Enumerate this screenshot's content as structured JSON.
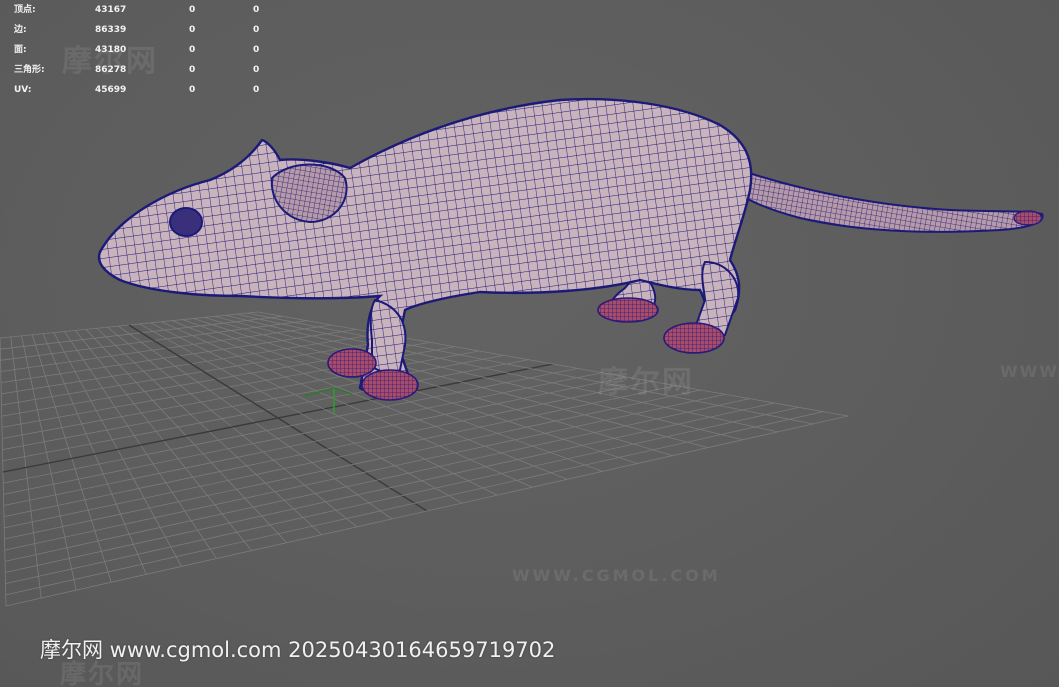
{
  "hud": {
    "rows": [
      {
        "label": "顶点:",
        "values": [
          "43167",
          "0",
          "0"
        ]
      },
      {
        "label": "边:",
        "values": [
          "86339",
          "0",
          "0"
        ]
      },
      {
        "label": "面:",
        "values": [
          "43180",
          "0",
          "0"
        ]
      },
      {
        "label": "三角形:",
        "values": [
          "86278",
          "0",
          "0"
        ]
      },
      {
        "label": "UV:",
        "values": [
          "45699",
          "0",
          "0"
        ]
      }
    ]
  },
  "watermarks": {
    "cn": "摩尔网",
    "url": "WWW.CGMOL.COM"
  },
  "footer": {
    "credit": "摩尔网 www.cgmol.com 20250430164659719702"
  },
  "colors": {
    "viewport_bg": "#5d5d5d",
    "grid_line": "#7b7b7b",
    "grid_axis": "#3a3a3a",
    "mesh_wire": "#1c1a78",
    "mesh_fill": "#c9b3bc",
    "feet_fill": "#a84c6c",
    "axis_x": "#2a7b2a",
    "axis_y": "#2e9b2e"
  },
  "icons": {
    "origin_gizmo": "axis-gizmo-icon"
  }
}
